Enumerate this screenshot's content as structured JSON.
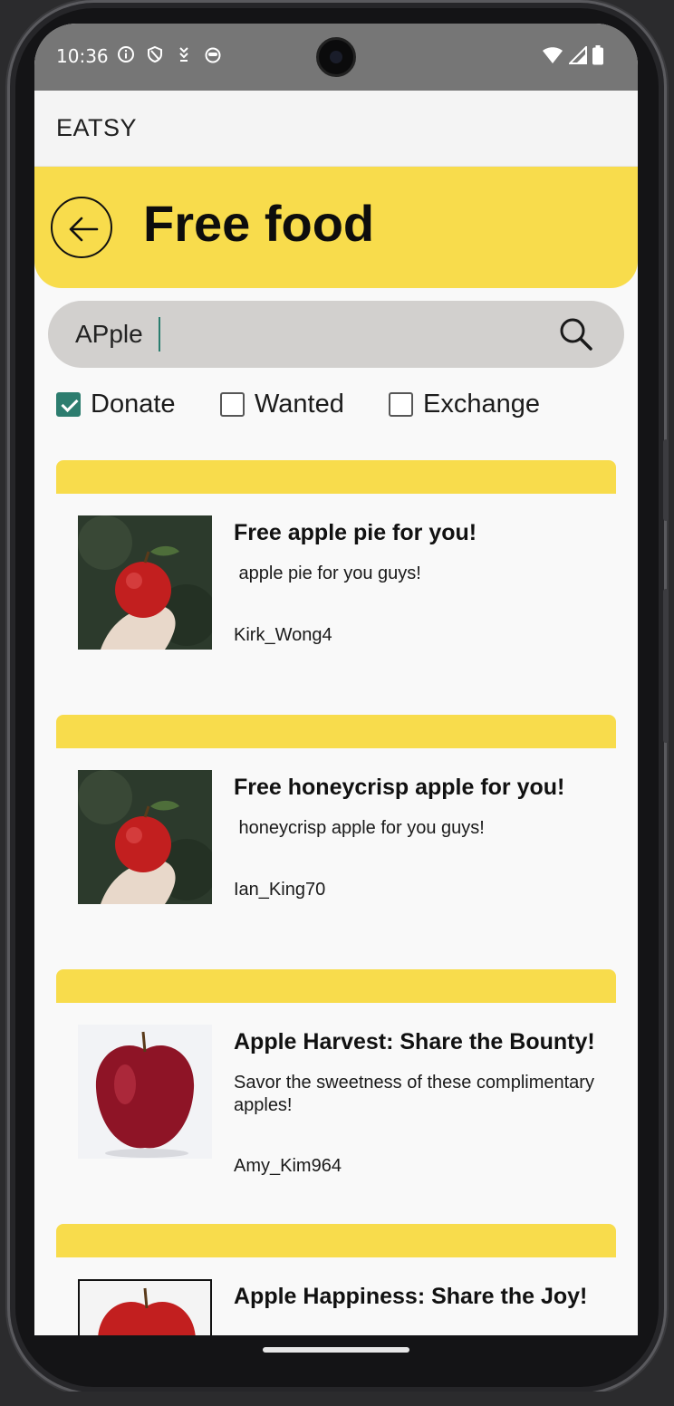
{
  "status_bar": {
    "time": "10:36",
    "left_icons": [
      "info-icon",
      "shield-icon",
      "download-arrows-icon",
      "face-icon"
    ],
    "right_icons": [
      "wifi-icon",
      "signal-icon",
      "battery-icon"
    ]
  },
  "app": {
    "title": "EATSY"
  },
  "header": {
    "title": "Free food",
    "back_icon": "arrow-left-icon"
  },
  "search": {
    "value": "APple",
    "icon": "search-icon"
  },
  "filters": [
    {
      "label": "Donate",
      "checked": true
    },
    {
      "label": "Wanted",
      "checked": false
    },
    {
      "label": "Exchange",
      "checked": false
    }
  ],
  "posts": [
    {
      "title": "Free apple pie for you!",
      "description": " apple pie for you guys!",
      "user": "Kirk_Wong4",
      "image": "apple-in-hand"
    },
    {
      "title": "Free honeycrisp apple for you!",
      "description": " honeycrisp apple for you guys!",
      "user": "Ian_King70",
      "image": "apple-in-hand"
    },
    {
      "title": "Apple Harvest: Share the Bounty!",
      "description": "Savor the sweetness of these complimentary apples!",
      "user": "Amy_Kim964",
      "image": "red-apple-white-background"
    },
    {
      "title": "Apple Happiness: Share the Joy!",
      "description": "",
      "user": "",
      "image": "red-apple-white-background"
    }
  ],
  "colors": {
    "accent_yellow": "#f8dc4c",
    "checkbox_green": "#2d7d6f",
    "search_bg": "#d2d0ce",
    "status_bar_bg": "#767676"
  }
}
